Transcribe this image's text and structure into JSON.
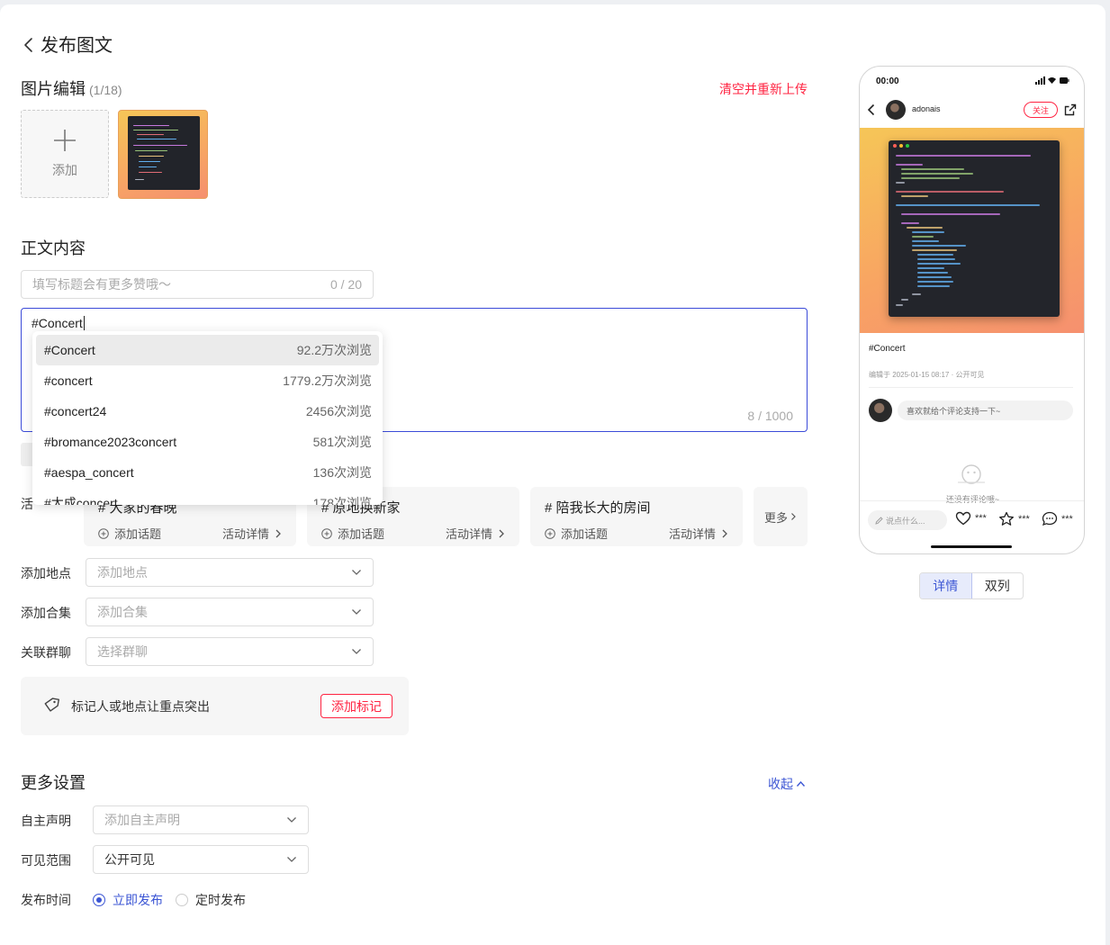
{
  "header": {
    "title": "发布图文"
  },
  "images": {
    "title": "图片编辑",
    "count": "(1/18)",
    "clear_label": "清空并重新上传",
    "add_label": "添加"
  },
  "content": {
    "title": "正文内容",
    "title_placeholder": "填写标题会有更多赞哦～",
    "title_counter": "0 / 20",
    "body_text": "#Concert",
    "body_counter": "8 / 1000"
  },
  "suggestions": [
    {
      "tag": "#Concert",
      "views": "92.2万次浏览"
    },
    {
      "tag": "#concert",
      "views": "1779.2万次浏览"
    },
    {
      "tag": "#concert24",
      "views": "2456次浏览"
    },
    {
      "tag": "#bromance2023concert",
      "views": "581次浏览"
    },
    {
      "tag": "#aespa_concert",
      "views": "136次浏览"
    },
    {
      "tag": "#太成concert",
      "views": "178次浏览"
    }
  ],
  "activity": {
    "label": "活",
    "cards": [
      {
        "name": "# 大家的春晚",
        "add": "添加话题",
        "detail": "活动详情"
      },
      {
        "name": "# 原地换新家",
        "add": "添加话题",
        "detail": "活动详情"
      },
      {
        "name": "# 陪我长大的房间",
        "add": "添加话题",
        "detail": "活动详情"
      }
    ],
    "more": "更多"
  },
  "fields": {
    "location": {
      "label": "添加地点",
      "placeholder": "添加地点"
    },
    "collection": {
      "label": "添加合集",
      "placeholder": "添加合集"
    },
    "group": {
      "label": "关联群聊",
      "placeholder": "选择群聊"
    }
  },
  "mark": {
    "text": "标记人或地点让重点突出",
    "button": "添加标记"
  },
  "more_settings": {
    "title": "更多设置",
    "collapse": "收起",
    "statement": {
      "label": "自主声明",
      "placeholder": "添加自主声明"
    },
    "visibility": {
      "label": "可见范围",
      "value": "公开可见"
    },
    "publish_time": {
      "label": "发布时间",
      "option_now": "立即发布",
      "option_scheduled": "定时发布",
      "selected": "立即发布"
    }
  },
  "preview": {
    "time": "00:00",
    "username": "adonais",
    "follow": "关注",
    "tag": "#Concert",
    "meta": "编辑于 2025-01-15 08:17 · 公开可见",
    "comment_placeholder": "喜欢就给个评论支持一下~",
    "empty": "还没有评论哦~",
    "say": "说点什么...",
    "like_count": "***",
    "star_count": "***",
    "comment_count": "***",
    "tabs": [
      "详情",
      "双列"
    ],
    "active_tab": "详情"
  },
  "colors": {
    "accent": "#3b55d4",
    "brand_red": "#ff2442",
    "image_gradient_start": "#f6c657",
    "image_gradient_end": "#f6906f"
  }
}
